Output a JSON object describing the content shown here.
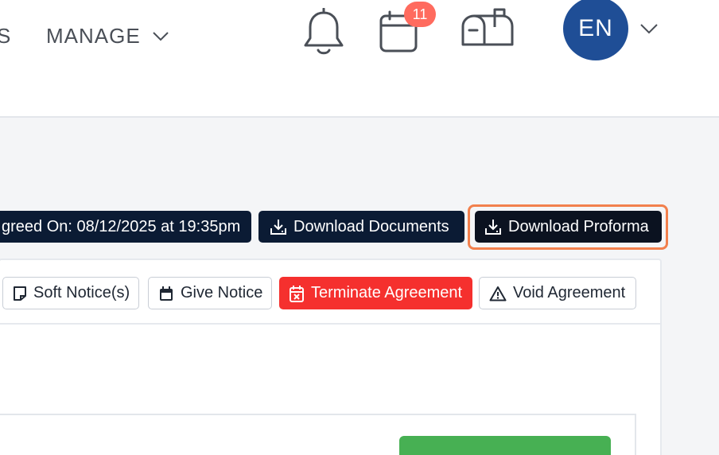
{
  "header": {
    "nav_fragment": "S",
    "manage_label": "MANAGE",
    "calendar_badge": "11",
    "avatar_initials": "EN"
  },
  "actions": {
    "agreed_on": "greed On: 08/12/2025 at 19:35pm",
    "download_documents": "Download Documents",
    "download_proforma": "Download Proforma"
  },
  "agreement_buttons": {
    "soft_notice": "Soft Notice(s)",
    "give_notice": "Give Notice",
    "terminate": "Terminate Agreement",
    "void": "Void Agreement"
  },
  "colors": {
    "dark_button": "#0b1b34",
    "highlight_ring": "#f2804d",
    "danger": "#f5302e",
    "avatar": "#1f4e96",
    "badge": "#ff6b5e",
    "success": "#47b053"
  }
}
